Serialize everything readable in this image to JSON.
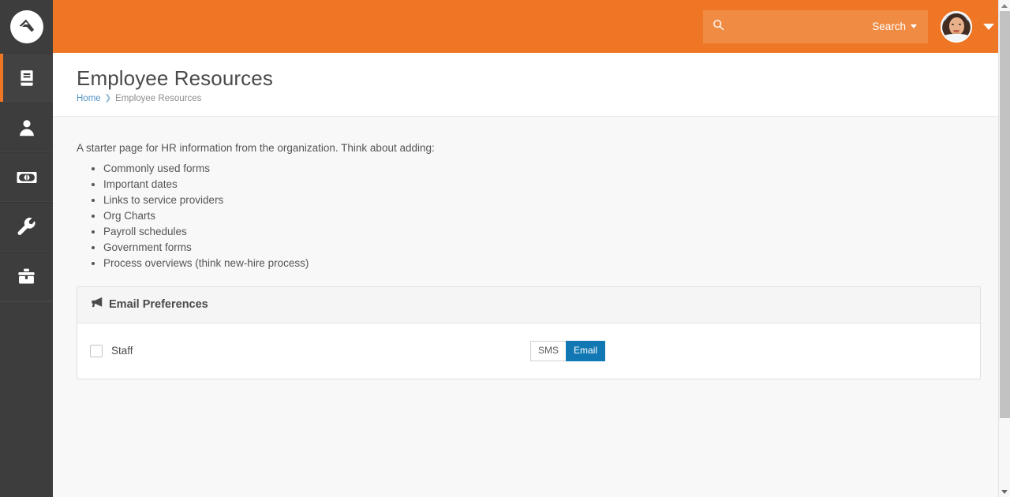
{
  "theme": {
    "brand_orange": "#ee7625",
    "search_bg": "#f08b43",
    "sidebar_bg": "#3d3d3d",
    "accent_blue": "#1278b3",
    "link_blue": "#4f93c4",
    "content_bg": "#f8f8f8"
  },
  "sidebar": {
    "logo_name": "rock-rms-logo",
    "items": [
      {
        "icon": "book-icon",
        "name": "cms",
        "active": true
      },
      {
        "icon": "person-icon",
        "name": "people",
        "active": false
      },
      {
        "icon": "money-icon",
        "name": "finance",
        "active": false
      },
      {
        "icon": "wrench-icon",
        "name": "tools",
        "active": false
      },
      {
        "icon": "toolbox-icon",
        "name": "admin",
        "active": false
      }
    ]
  },
  "header": {
    "search": {
      "icon": "search-icon",
      "value": "",
      "placeholder": "",
      "label": "Search",
      "caret_icon": "caret-down-icon"
    },
    "user": {
      "avatar_name": "user-avatar",
      "chevron_icon": "chevron-down-icon"
    }
  },
  "page": {
    "title": "Employee Resources",
    "breadcrumb": {
      "home_label": "Home",
      "separator": "❯",
      "current_label": "Employee Resources"
    }
  },
  "content": {
    "intro": "A starter page for HR information from the organization. Think about adding:",
    "bullets": [
      "Commonly used forms",
      "Important dates",
      "Links to service providers",
      "Org Charts",
      "Payroll  schedules",
      "Government forms",
      "Process overviews (think new-hire process)"
    ]
  },
  "panel": {
    "icon": "bullhorn-icon",
    "title": "Email Preferences",
    "rows": [
      {
        "checkbox_checked": false,
        "label": "Staff",
        "buttons": [
          {
            "label": "SMS",
            "active": false
          },
          {
            "label": "Email",
            "active": true
          }
        ]
      }
    ]
  },
  "scrollbar": {
    "up_icon": "scroll-up-arrow-icon",
    "down_icon": "scroll-down-arrow-icon",
    "thumb_name": "scroll-thumb"
  }
}
